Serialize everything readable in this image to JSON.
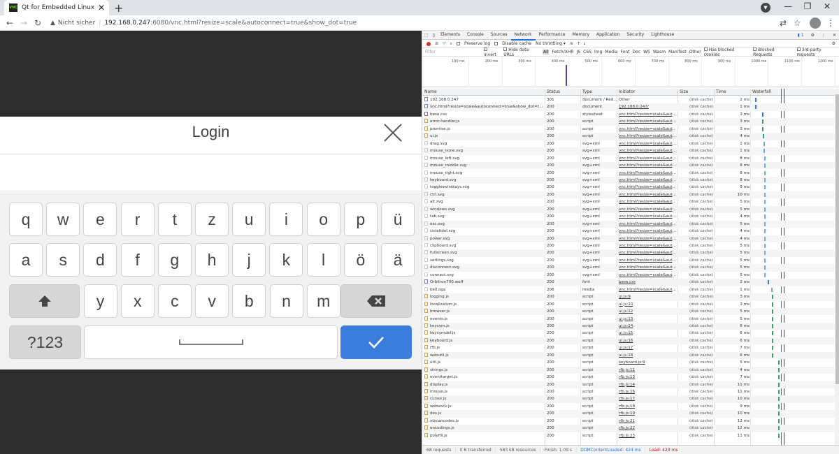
{
  "browser": {
    "tab_title": "Qt for Embedded Linux VNC Ser",
    "favicon_text": "VNC",
    "security_label": "Nicht sicher",
    "url_host": "192.168.0.247",
    "url_path": ":6080/vnc.html?resize=scale&autoconnect=true&show_dot=true"
  },
  "login": {
    "title": "Login"
  },
  "keyboard": {
    "row1": [
      "q",
      "w",
      "e",
      "r",
      "t",
      "z",
      "u",
      "i",
      "o",
      "p",
      "ü"
    ],
    "row2": [
      "a",
      "s",
      "d",
      "f",
      "g",
      "h",
      "j",
      "k",
      "l",
      "ö",
      "ä"
    ],
    "row3": [
      "y",
      "x",
      "c",
      "v",
      "b",
      "n",
      "m"
    ],
    "mode_label": "?123",
    "shift_icon": "shift-arrow-icon",
    "backspace_icon": "backspace-icon",
    "enter_icon": "checkmark-icon",
    "accent_color": "#3b7ddd"
  },
  "devtools": {
    "tabs": [
      "Elements",
      "Console",
      "Sources",
      "Network",
      "Performance",
      "Memory",
      "Application",
      "Security",
      "Lighthouse"
    ],
    "active_tab": "Network",
    "issues_count": "1",
    "preserve_log": "Preserve log",
    "disable_cache": "Disable cache",
    "throttling": "No throttling",
    "filter_placeholder": "Filter",
    "invert": "Invert",
    "hide_data_urls": "Hide data URLs",
    "filter_types": [
      "All",
      "Fetch/XHR",
      "JS",
      "CSS",
      "Img",
      "Media",
      "Font",
      "Doc",
      "WS",
      "Wasm",
      "Manifest",
      "Other"
    ],
    "blocked_cookies": "Has blocked cookies",
    "blocked_requests": "Blocked Requests",
    "third_party": "3rd-party requests",
    "overview_ticks": [
      "100 ms",
      "200 ms",
      "300 ms",
      "400 ms",
      "500 ms",
      "600 ms",
      "700 ms",
      "800 ms",
      "900 ms",
      "1000 ms",
      "1100 ms",
      "1200 ms"
    ],
    "columns": [
      "Name",
      "Status",
      "Type",
      "Initiator",
      "Size",
      "Time",
      "Waterfall"
    ],
    "rows": [
      {
        "name": "192.168.0.247",
        "status": "301",
        "type": "document / Red...",
        "initiator": "Other",
        "size": "(disk cache)",
        "time": "2 ms",
        "icon": "doc",
        "wf": 0.005
      },
      {
        "name": "vnc.html?resize=scale&autoconnect=true&show_dot=true",
        "status": "200",
        "type": "document",
        "initiator": "192.168.0.247/",
        "size": "(disk cache)",
        "time": "1 ms",
        "icon": "doc",
        "wf": 0.01
      },
      {
        "name": "base.css",
        "status": "200",
        "type": "stylesheet",
        "initiator": "vnc.html?resize=scale&autoc...",
        "size": "(disk cache)",
        "time": "3 ms",
        "icon": "css",
        "wf": 0.1
      },
      {
        "name": "error-handler.js",
        "status": "200",
        "type": "script",
        "initiator": "vnc.html?resize=scale&autoc...",
        "size": "(disk cache)",
        "time": "3 ms",
        "icon": "script",
        "wf": 0.1
      },
      {
        "name": "promise.js",
        "status": "200",
        "type": "script",
        "initiator": "vnc.html?resize=scale&autoc...",
        "size": "(disk cache)",
        "time": "3 ms",
        "icon": "script",
        "wf": 0.1
      },
      {
        "name": "ui.js",
        "status": "200",
        "type": "script",
        "initiator": "vnc.html?resize=scale&autoc...",
        "size": "(disk cache)",
        "time": "4 ms",
        "icon": "script",
        "wf": 0.11
      },
      {
        "name": "drag.svg",
        "status": "200",
        "type": "svg+xml",
        "initiator": "vnc.html?resize=scale&autoc...",
        "size": "(disk cache)",
        "time": "1 ms",
        "icon": "svg",
        "wf": 0.12
      },
      {
        "name": "mouse_none.svg",
        "status": "200",
        "type": "svg+xml",
        "initiator": "vnc.html?resize=scale&autoc...",
        "size": "(disk cache)",
        "time": "1 ms",
        "icon": "svg",
        "wf": 0.12
      },
      {
        "name": "mouse_left.svg",
        "status": "200",
        "type": "svg+xml",
        "initiator": "vnc.html?resize=scale&autoc...",
        "size": "(disk cache)",
        "time": "8 ms",
        "icon": "svg",
        "wf": 0.13
      },
      {
        "name": "mouse_middle.svg",
        "status": "200",
        "type": "svg+xml",
        "initiator": "vnc.html?resize=scale&autoc...",
        "size": "(disk cache)",
        "time": "8 ms",
        "icon": "svg",
        "wf": 0.13
      },
      {
        "name": "mouse_right.svg",
        "status": "200",
        "type": "svg+xml",
        "initiator": "vnc.html?resize=scale&autoc...",
        "size": "(disk cache)",
        "time": "8 ms",
        "icon": "svg",
        "wf": 0.13
      },
      {
        "name": "keyboard.svg",
        "status": "200",
        "type": "svg+xml",
        "initiator": "vnc.html?resize=scale&autoc...",
        "size": "(disk cache)",
        "time": "8 ms",
        "icon": "svg",
        "wf": 0.13
      },
      {
        "name": "toggleextrakeys.svg",
        "status": "200",
        "type": "svg+xml",
        "initiator": "vnc.html?resize=scale&autoc...",
        "size": "(disk cache)",
        "time": "9 ms",
        "icon": "svg",
        "wf": 0.13
      },
      {
        "name": "ctrl.svg",
        "status": "200",
        "type": "svg+xml",
        "initiator": "vnc.html?resize=scale&autoc...",
        "size": "(disk cache)",
        "time": "10 ms",
        "icon": "svg",
        "wf": 0.13
      },
      {
        "name": "alt.svg",
        "status": "200",
        "type": "svg+xml",
        "initiator": "vnc.html?resize=scale&autoc...",
        "size": "(disk cache)",
        "time": "5 ms",
        "icon": "svg",
        "wf": 0.13
      },
      {
        "name": "windows.svg",
        "status": "200",
        "type": "svg+xml",
        "initiator": "vnc.html?resize=scale&autoc...",
        "size": "(disk cache)",
        "time": "5 ms",
        "icon": "svg",
        "wf": 0.13
      },
      {
        "name": "tab.svg",
        "status": "200",
        "type": "svg+xml",
        "initiator": "vnc.html?resize=scale&autoc...",
        "size": "(disk cache)",
        "time": "4 ms",
        "icon": "svg",
        "wf": 0.13
      },
      {
        "name": "esc.svg",
        "status": "200",
        "type": "svg+xml",
        "initiator": "vnc.html?resize=scale&autoc...",
        "size": "(disk cache)",
        "time": "5 ms",
        "icon": "svg",
        "wf": 0.13
      },
      {
        "name": "ctrlaltdel.svg",
        "status": "200",
        "type": "svg+xml",
        "initiator": "vnc.html?resize=scale&autoc...",
        "size": "(disk cache)",
        "time": "4 ms",
        "icon": "svg",
        "wf": 0.13
      },
      {
        "name": "power.svg",
        "status": "200",
        "type": "svg+xml",
        "initiator": "vnc.html?resize=scale&autoc...",
        "size": "(disk cache)",
        "time": "4 ms",
        "icon": "svg",
        "wf": 0.13
      },
      {
        "name": "clipboard.svg",
        "status": "200",
        "type": "svg+xml",
        "initiator": "vnc.html?resize=scale&autoc...",
        "size": "(disk cache)",
        "time": "5 ms",
        "icon": "svg",
        "wf": 0.13
      },
      {
        "name": "fullscreen.svg",
        "status": "200",
        "type": "svg+xml",
        "initiator": "vnc.html?resize=scale&autoc...",
        "size": "(disk cache)",
        "time": "5 ms",
        "icon": "svg",
        "wf": 0.13
      },
      {
        "name": "settings.svg",
        "status": "200",
        "type": "svg+xml",
        "initiator": "vnc.html?resize=scale&autoc...",
        "size": "(disk cache)",
        "time": "5 ms",
        "icon": "svg",
        "wf": 0.13
      },
      {
        "name": "disconnect.svg",
        "status": "200",
        "type": "svg+xml",
        "initiator": "vnc.html?resize=scale&autoc...",
        "size": "(disk cache)",
        "time": "5 ms",
        "icon": "svg",
        "wf": 0.13
      },
      {
        "name": "connect.svg",
        "status": "200",
        "type": "svg+xml",
        "initiator": "vnc.html?resize=scale&autoc...",
        "size": "(disk cache)",
        "time": "5 ms",
        "icon": "svg",
        "wf": 0.13
      },
      {
        "name": "Orbitron700.woff",
        "status": "200",
        "type": "font",
        "initiator": "base.css",
        "size": "(disk cache)",
        "time": "2 ms",
        "icon": "font",
        "wf": 0.17
      },
      {
        "name": "bell.oga",
        "status": "206",
        "type": "media",
        "initiator": "vnc.html?resize=scale&autoc...",
        "size": "(disk cache)",
        "time": "1 ms",
        "icon": "svg",
        "wf": 0.22
      },
      {
        "name": "logging.js",
        "status": "200",
        "type": "script",
        "initiator": "ui.js:9",
        "size": "(disk cache)",
        "time": "3 ms",
        "icon": "script",
        "wf": 0.23
      },
      {
        "name": "localization.js",
        "status": "200",
        "type": "script",
        "initiator": "ui.js:10",
        "size": "(disk cache)",
        "time": "3 ms",
        "icon": "script",
        "wf": 0.23
      },
      {
        "name": "browser.js",
        "status": "200",
        "type": "script",
        "initiator": "ui.js:12",
        "size": "(disk cache)",
        "time": "5 ms",
        "icon": "script",
        "wf": 0.23
      },
      {
        "name": "events.js",
        "status": "200",
        "type": "script",
        "initiator": "ui.js:13",
        "size": "(disk cache)",
        "time": "5 ms",
        "icon": "script",
        "wf": 0.23
      },
      {
        "name": "keysym.js",
        "status": "200",
        "type": "script",
        "initiator": "ui.js:14",
        "size": "(disk cache)",
        "time": "6 ms",
        "icon": "script",
        "wf": 0.23
      },
      {
        "name": "keysymdef.js",
        "status": "200",
        "type": "script",
        "initiator": "ui.js:15",
        "size": "(disk cache)",
        "time": "6 ms",
        "icon": "script",
        "wf": 0.23
      },
      {
        "name": "keyboard.js",
        "status": "200",
        "type": "script",
        "initiator": "ui.js:16",
        "size": "(disk cache)",
        "time": "6 ms",
        "icon": "script",
        "wf": 0.23
      },
      {
        "name": "rfb.js",
        "status": "200",
        "type": "script",
        "initiator": "ui.js:17",
        "size": "(disk cache)",
        "time": "7 ms",
        "icon": "script",
        "wf": 0.23
      },
      {
        "name": "webutil.js",
        "status": "200",
        "type": "script",
        "initiator": "ui.js:18",
        "size": "(disk cache)",
        "time": "6 ms",
        "icon": "script",
        "wf": 0.23
      },
      {
        "name": "util.js",
        "status": "200",
        "type": "script",
        "initiator": "keyboard.js:9",
        "size": "(disk cache)",
        "time": "5 ms",
        "icon": "script",
        "wf": 0.31
      },
      {
        "name": "strings.js",
        "status": "200",
        "type": "script",
        "initiator": "rfb.js:11",
        "size": "(disk cache)",
        "time": "4 ms",
        "icon": "script",
        "wf": 0.31
      },
      {
        "name": "eventtarget.js",
        "status": "200",
        "type": "script",
        "initiator": "rfb.js:13",
        "size": "(disk cache)",
        "time": "7 ms",
        "icon": "script",
        "wf": 0.31
      },
      {
        "name": "display.js",
        "status": "200",
        "type": "script",
        "initiator": "rfb.js:14",
        "size": "(disk cache)",
        "time": "11 ms",
        "icon": "script",
        "wf": 0.31
      },
      {
        "name": "mouse.js",
        "status": "200",
        "type": "script",
        "initiator": "rfb.js:16",
        "size": "(disk cache)",
        "time": "11 ms",
        "icon": "script",
        "wf": 0.31
      },
      {
        "name": "cursor.js",
        "status": "200",
        "type": "script",
        "initiator": "rfb.js:17",
        "size": "(disk cache)",
        "time": "10 ms",
        "icon": "script",
        "wf": 0.31
      },
      {
        "name": "websock.js",
        "status": "200",
        "type": "script",
        "initiator": "rfb.js:18",
        "size": "(disk cache)",
        "time": "9 ms",
        "icon": "script",
        "wf": 0.31
      },
      {
        "name": "des.js",
        "status": "200",
        "type": "script",
        "initiator": "rfb.js:19",
        "size": "(disk cache)",
        "time": "10 ms",
        "icon": "script",
        "wf": 0.31
      },
      {
        "name": "xtscancodes.js",
        "status": "200",
        "type": "script",
        "initiator": "rfb.js:21",
        "size": "(disk cache)",
        "time": "12 ms",
        "icon": "script",
        "wf": 0.31
      },
      {
        "name": "encodings.js",
        "status": "200",
        "type": "script",
        "initiator": "rfb.js:22",
        "size": "(disk cache)",
        "time": "12 ms",
        "icon": "script",
        "wf": 0.31
      },
      {
        "name": "polyfill.js",
        "status": "200",
        "type": "script",
        "initiator": "rfb.js:23",
        "size": "(disk cache)",
        "time": "11 ms",
        "icon": "script",
        "wf": 0.31
      }
    ],
    "status_bar": {
      "requests": "68 requests",
      "transferred": "0 B transferred",
      "resources": "583 kB resources",
      "finish": "Finish: 1.09 s",
      "dcl": "DOMContentLoaded: 424 ms",
      "load": "Load: 423 ms"
    }
  }
}
